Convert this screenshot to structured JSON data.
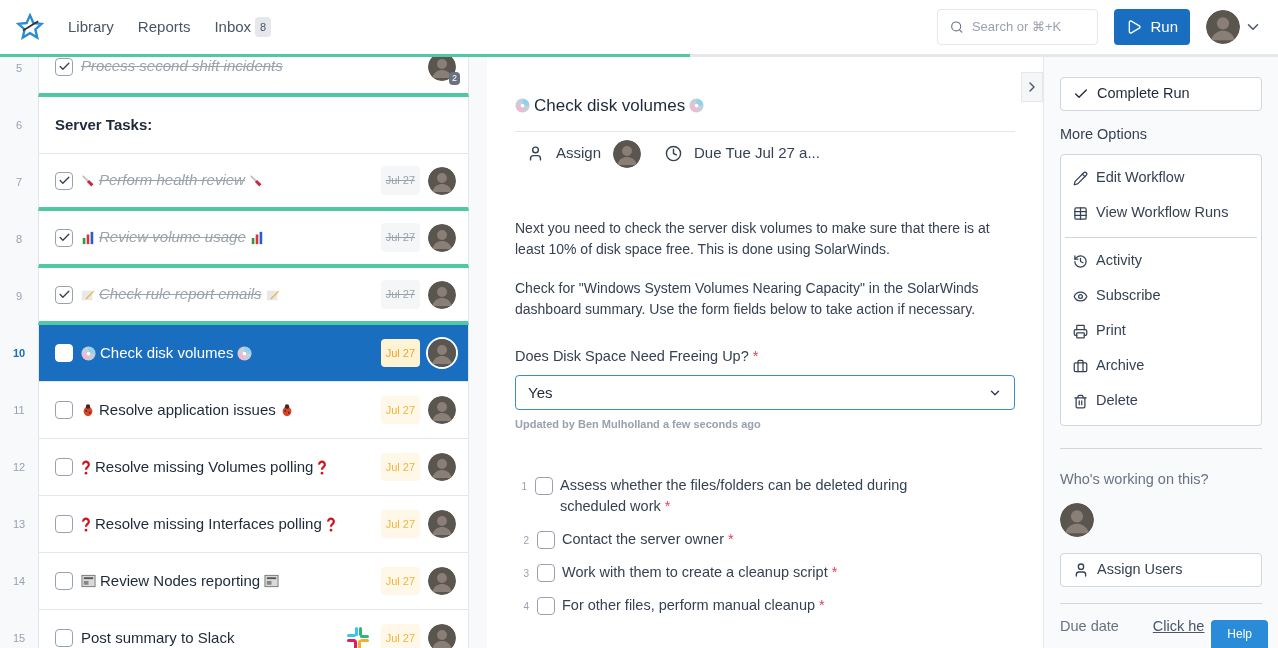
{
  "header": {
    "nav": [
      {
        "label": "Library"
      },
      {
        "label": "Reports"
      },
      {
        "label": "Inbox",
        "badge": "8"
      }
    ],
    "search": {
      "placeholder": "Search or ⌘+K"
    },
    "run_button": "Run"
  },
  "progress": {
    "level": 0.54
  },
  "tasks": [
    {
      "number": "5",
      "kind": "task",
      "title": "Process second shift incidents",
      "checked": true,
      "selected": false,
      "avatar_badge": "2"
    },
    {
      "number": "6",
      "kind": "heading",
      "title": "Server Tasks:"
    },
    {
      "number": "7",
      "kind": "task",
      "marker": {
        "kind": "syringe"
      },
      "title": "Perform health review",
      "checked": true,
      "selected": false,
      "due": "Jul 27"
    },
    {
      "number": "8",
      "kind": "task",
      "marker": {
        "kind": "chart"
      },
      "title": "Review volume usage",
      "checked": true,
      "selected": false,
      "due": "Jul 27"
    },
    {
      "number": "9",
      "kind": "task",
      "marker": {
        "kind": "pencil"
      },
      "title": "Check rule report emails",
      "checked": true,
      "selected": false,
      "due": "Jul 27"
    },
    {
      "number": "10",
      "kind": "task",
      "marker": {
        "kind": "disc"
      },
      "title": "Check disk volumes",
      "checked": false,
      "selected": true,
      "due": "Jul 27"
    },
    {
      "number": "11",
      "kind": "task",
      "marker": {
        "kind": "bug"
      },
      "title": "Resolve application issues",
      "checked": false,
      "selected": false,
      "due": "Jul 27"
    },
    {
      "number": "12",
      "kind": "task",
      "marker": {
        "kind": "question"
      },
      "title": "Resolve missing Volumes polling",
      "checked": false,
      "selected": false,
      "due": "Jul 27"
    },
    {
      "number": "13",
      "kind": "task",
      "marker": {
        "kind": "question"
      },
      "title": "Resolve missing Interfaces polling",
      "checked": false,
      "selected": false,
      "due": "Jul 27"
    },
    {
      "number": "14",
      "kind": "task",
      "marker": {
        "kind": "newspaper"
      },
      "title": "Review Nodes reporting",
      "checked": false,
      "selected": false,
      "due": "Jul 27"
    },
    {
      "number": "15",
      "kind": "task",
      "title": "Post summary to Slack",
      "checked": false,
      "selected": false,
      "due": "Jul 27",
      "integration": true
    }
  ],
  "detail": {
    "marker": {
      "kind": "disc"
    },
    "title": "Check disk volumes",
    "assign": "Assign",
    "due": "Due Tue Jul 27 a...",
    "paragraphs": [
      "Next you need to check the server disk volumes to make sure that there is at least 10% of disk space free. This is done using SolarWinds.",
      "Check for \"Windows System Volumes Nearing Capacity\" in the SolarWinds dashboard summary. Use the form fields below to take action if necessary."
    ],
    "field": {
      "label": "Does Disk Space Need Freeing Up?",
      "required_mark": "*",
      "value": "Yes",
      "updated": "Updated by Ben Mulholland a few seconds ago"
    },
    "subtasks": [
      {
        "number": "1",
        "label": "Assess whether the files/folders can be deleted during scheduled work",
        "required_mark": "*",
        "checked": false
      },
      {
        "number": "2",
        "label": "Contact the server owner",
        "required_mark": "*",
        "checked": false
      },
      {
        "number": "3",
        "label": "Work with them to create a cleanup script",
        "required_mark": "*",
        "checked": false
      },
      {
        "number": "4",
        "label": "For other files, perform manual cleanup",
        "required_mark": "*",
        "checked": false
      }
    ]
  },
  "sidebar": {
    "complete_button": "Complete Run",
    "more_options": "More Options",
    "menu_groups": [
      [
        {
          "kind": "edit",
          "label": "Edit Workflow"
        },
        {
          "kind": "runs",
          "label": "View Workflow Runs"
        }
      ],
      [
        {
          "kind": "activity",
          "label": "Activity"
        },
        {
          "kind": "subscribe",
          "label": "Subscribe"
        },
        {
          "kind": "print",
          "label": "Print"
        },
        {
          "kind": "archive",
          "label": "Archive"
        },
        {
          "kind": "delete",
          "label": "Delete"
        }
      ]
    ],
    "working_title": "Who's working on this?",
    "assign_users": "Assign Users",
    "due_label": "Due date",
    "due_link": "Click he"
  },
  "help_button": "Help"
}
